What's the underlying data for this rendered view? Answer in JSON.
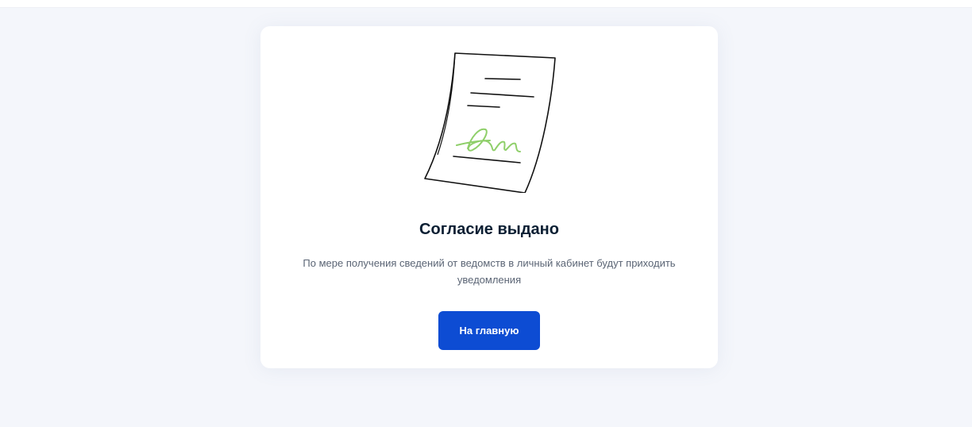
{
  "result": {
    "illustration_icon": "signed-document-icon",
    "title": "Согласие выдано",
    "description": "По мере получения сведений от ведомств в личный кабинет будут приходить уведомления",
    "home_button_label": "На главную"
  },
  "colors": {
    "accent": "#0d4cd3",
    "signature": "#8fcf6a",
    "title_text": "#0b1f33",
    "body_text": "#5b6575",
    "page_background": "#f4f6fb",
    "card_background": "#ffffff"
  }
}
